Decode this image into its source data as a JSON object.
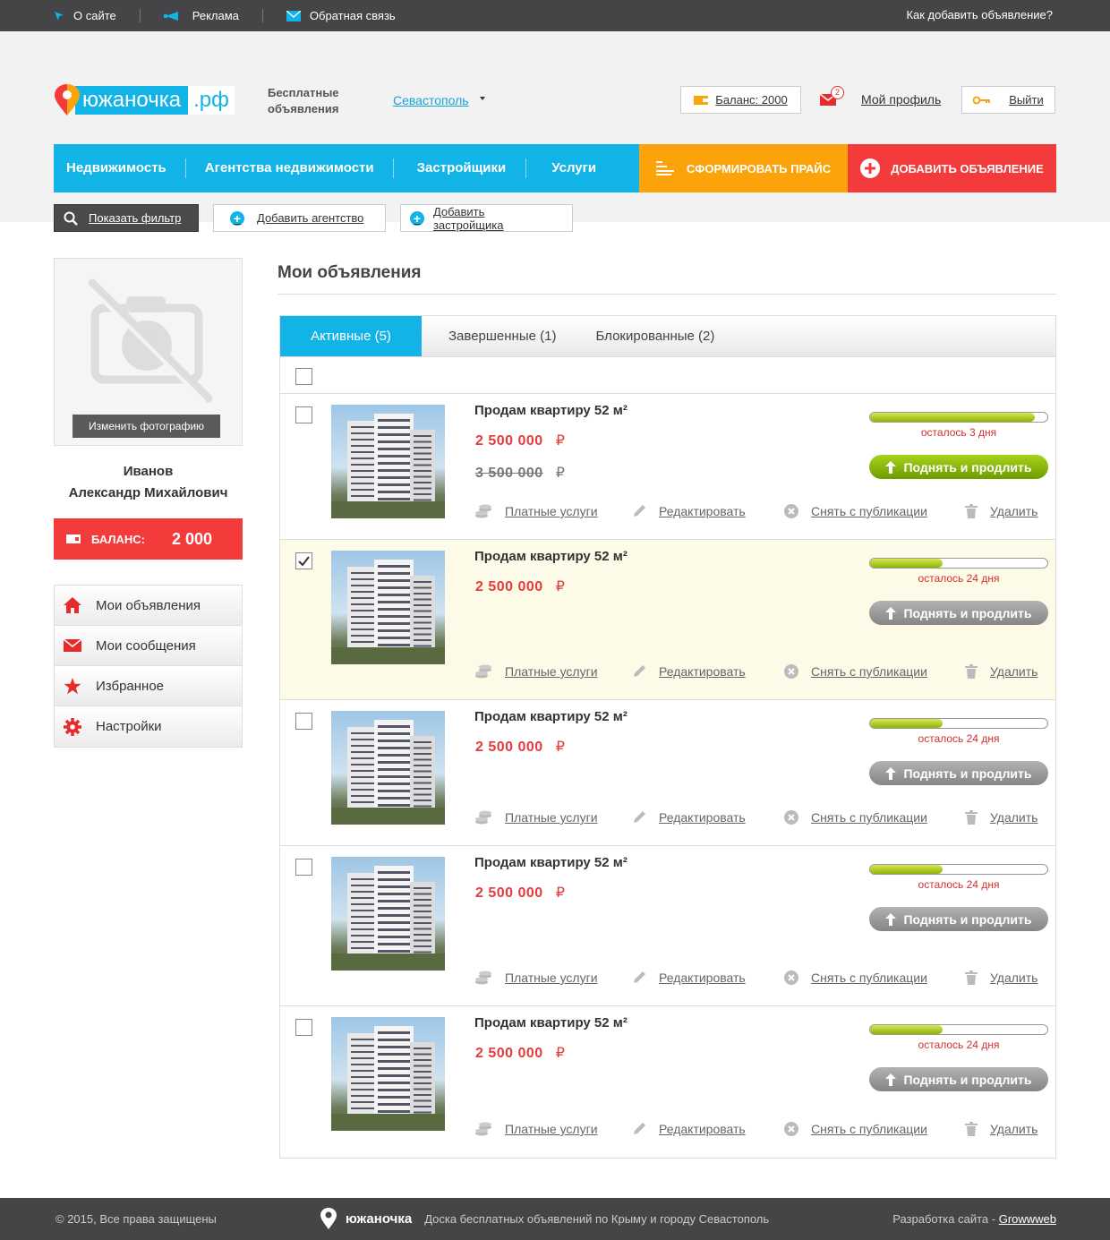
{
  "topbar": {
    "links": [
      {
        "label": "О сайте",
        "icon": "cursor-icon"
      },
      {
        "label": "Реклама",
        "icon": "megaphone-icon"
      },
      {
        "label": "Обратная связь",
        "icon": "envelope-icon"
      }
    ],
    "howto": "Как добавить объявление?"
  },
  "header": {
    "logo_word": "южаночка",
    "logo_rf": ".рф",
    "slogan": "Бесплатные объявления",
    "city": "Севастополь",
    "balance_label": "Баланс: 2000",
    "mail_badge": "2",
    "profile_label": "Мой профиль",
    "logout_label": "Выйти"
  },
  "nav": {
    "items": [
      "Недвижимость",
      "Агентства недвижимости",
      "Застройщики",
      "Услуги"
    ],
    "price_label": "СФОРМИРОВАТЬ ПРАЙС",
    "add_label": "ДОБАВИТЬ ОБЪЯВЛЕНИЕ"
  },
  "subbar": {
    "filter_label": "Показать фильтр",
    "agency_label": "Добавить агентство",
    "developer_label": "Добавить застройщика"
  },
  "sidebar": {
    "change_photo": "Изменить фотографию",
    "surname": "Иванов",
    "given_names": "Александр Михайлович",
    "balance_label": "БАЛАНС:",
    "balance_value": "2 000",
    "menu": [
      "Мои объявления",
      "Мои сообщения",
      "Избранное",
      "Настройки"
    ]
  },
  "main": {
    "title": "Мои объявления",
    "tabs": [
      "Активные (5)",
      "Завершенные (1)",
      "Блокированные (2)"
    ],
    "actions": {
      "paid": "Платные услуги",
      "edit": "Редактировать",
      "unpublish": "Снять с публикации",
      "delete": "Удалить",
      "lift": "Поднять и продлить"
    },
    "currency": "₽",
    "items": [
      {
        "title": "Продам квартиру 52 м²",
        "price": "2 500 000",
        "old_price": "3 500 000",
        "remaining": "осталось 3 дня",
        "progress": 0.93,
        "checked": false
      },
      {
        "title": "Продам квартиру 52 м²",
        "price": "2 500 000",
        "old_price": "",
        "remaining": "осталось 24 дня",
        "progress": 0.41,
        "checked": true
      },
      {
        "title": "Продам квартиру 52 м²",
        "price": "2 500 000",
        "old_price": "",
        "remaining": "осталось 24 дня",
        "progress": 0.41,
        "checked": false
      },
      {
        "title": "Продам квартиру 52 м²",
        "price": "2 500 000",
        "old_price": "",
        "remaining": "осталось 24 дня",
        "progress": 0.41,
        "checked": false
      },
      {
        "title": "Продам квартиру 52 м²",
        "price": "2 500 000",
        "old_price": "",
        "remaining": "осталось 24 дня",
        "progress": 0.41,
        "checked": false
      }
    ]
  },
  "footer": {
    "copyright": "© 2015, Все права защищены",
    "brand": "южаночка",
    "tagline": "Доска бесплатных объявлений по Крыму и городу Севастополь",
    "dev_prefix": "Разработка сайта -",
    "dev_link": "Growwweb"
  },
  "colors": {
    "accent": "#12b3e6",
    "orange": "#fca30b",
    "red": "#f33b3b",
    "price": "#e43b3b"
  }
}
